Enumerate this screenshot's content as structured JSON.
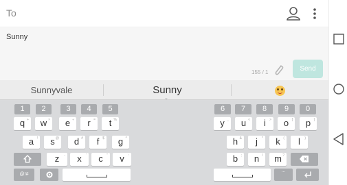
{
  "compose": {
    "to_label": "To",
    "message_text": "Sunny",
    "char_count": "155 / 1",
    "send_label": "Send"
  },
  "suggestions": [
    "Sunnyvale",
    "Sunny"
  ],
  "keyboard": {
    "numbers_left": [
      "1",
      "2",
      "3",
      "4",
      "5"
    ],
    "numbers_right": [
      "6",
      "7",
      "8",
      "9",
      "0"
    ],
    "row1_left": [
      {
        "label": "q",
        "hint": "+"
      },
      {
        "label": "w",
        "hint": "×"
      },
      {
        "label": "e",
        "hint": "÷"
      },
      {
        "label": "r",
        "hint": "="
      },
      {
        "label": "t",
        "hint": "%"
      }
    ],
    "row1_right": [
      {
        "label": "y",
        "hint": "_"
      },
      {
        "label": "u",
        "hint": "<"
      },
      {
        "label": "i",
        "hint": ">"
      },
      {
        "label": "o",
        "hint": "["
      },
      {
        "label": "p",
        "hint": "]"
      }
    ],
    "row2_left": [
      {
        "label": "a",
        "hint": "!"
      },
      {
        "label": "s",
        "hint": "@"
      },
      {
        "label": "d",
        "hint": "#"
      },
      {
        "label": "f",
        "hint": "$"
      },
      {
        "label": "g",
        "hint": "^"
      }
    ],
    "row2_right": [
      {
        "label": "h",
        "hint": "&"
      },
      {
        "label": "j",
        "hint": "*"
      },
      {
        "label": "k",
        "hint": "("
      },
      {
        "label": "l",
        "hint": ")"
      }
    ],
    "row3_left": [
      {
        "label": "z",
        "hint": "-"
      },
      {
        "label": "x",
        "hint": "'"
      },
      {
        "label": "c",
        "hint": "\""
      },
      {
        "label": "v",
        "hint": ":"
      }
    ],
    "row3_right": [
      {
        "label": "b",
        "hint": ";"
      },
      {
        "label": "n",
        "hint": "/"
      },
      {
        "label": "m",
        "hint": "?"
      }
    ],
    "symbols_label": "@!#",
    "settings_hint": "...",
    "dots_hint": "..."
  },
  "colors": {
    "send_disabled": "#bfe6df",
    "keyboard_bg": "#d9dadc",
    "dark_key": "#a9abae"
  },
  "icons": {
    "contact": "person-icon",
    "more": "more-vert-icon",
    "attach": "paperclip-icon",
    "emoji": "smiley-emoji-icon",
    "shift": "shift-icon",
    "backspace": "backspace-icon",
    "enter": "enter-icon",
    "recent": "recent-apps-icon",
    "home": "home-icon",
    "back": "back-icon"
  }
}
